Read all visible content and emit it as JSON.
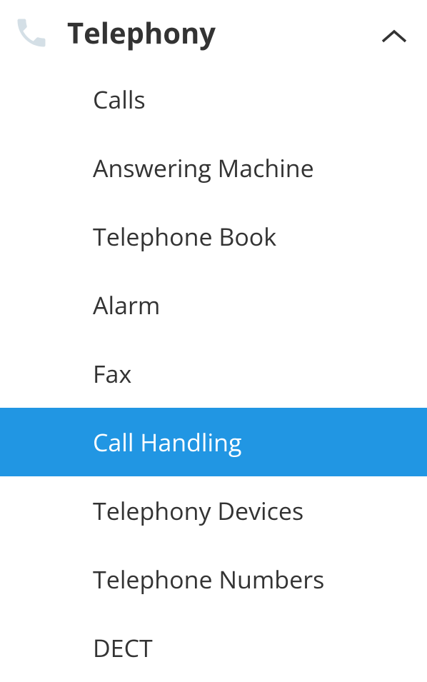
{
  "menu": {
    "title": "Telephony",
    "icon": "phone-icon",
    "expanded": true,
    "items": [
      {
        "label": "Calls",
        "active": false
      },
      {
        "label": "Answering Machine",
        "active": false
      },
      {
        "label": "Telephone Book",
        "active": false
      },
      {
        "label": "Alarm",
        "active": false
      },
      {
        "label": "Fax",
        "active": false
      },
      {
        "label": "Call Handling",
        "active": true
      },
      {
        "label": "Telephony Devices",
        "active": false
      },
      {
        "label": "Telephone Numbers",
        "active": false
      },
      {
        "label": "DECT",
        "active": false
      }
    ],
    "colors": {
      "active_bg": "#2196e3",
      "text": "#333333",
      "icon": "#d4dfe6"
    }
  }
}
